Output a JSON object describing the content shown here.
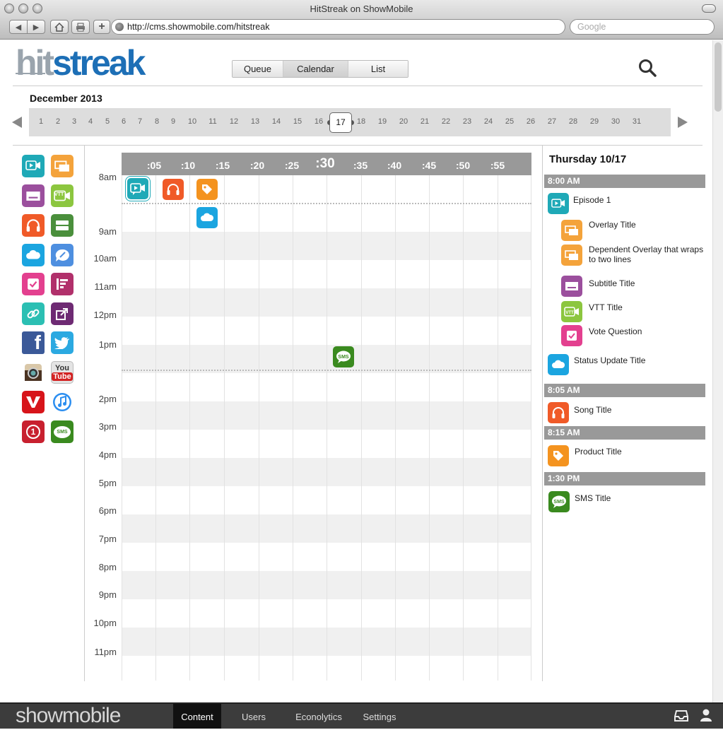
{
  "browser": {
    "window_title": "HitStreak on ShowMobile",
    "url": "http://cms.showmobile.com/hitstreak",
    "search_placeholder": "Google"
  },
  "header": {
    "logo_part1": "hit",
    "logo_part2": "streak",
    "view_tabs": [
      "Queue",
      "Calendar",
      "List"
    ],
    "active_view": "Calendar"
  },
  "calendar": {
    "month_label": "December 2013",
    "days": [
      "1",
      "2",
      "3",
      "4",
      "5",
      "6",
      "7",
      "8",
      "9",
      "10",
      "11",
      "12",
      "13",
      "14",
      "15",
      "16",
      "17",
      "18",
      "19",
      "20",
      "21",
      "22",
      "23",
      "24",
      "25",
      "26",
      "27",
      "28",
      "29",
      "30",
      "31"
    ],
    "selected_day": "17",
    "minute_labels": [
      ":05",
      ":10",
      ":15",
      ":20",
      ":25",
      ":30",
      ":35",
      ":40",
      ":45",
      ":50",
      ":55"
    ],
    "hour_labels": [
      "8am",
      "9am",
      "10am",
      "11am",
      "12pm",
      "1pm",
      "2pm",
      "3pm",
      "4pm",
      "5pm",
      "6pm",
      "7pm",
      "8pm",
      "9pm",
      "10pm",
      "11pm"
    ]
  },
  "palette": {
    "items": [
      {
        "name": "video",
        "color": "#1fa9b7"
      },
      {
        "name": "overlay",
        "color": "#f4a33b"
      },
      {
        "name": "subtitle",
        "color": "#9b4f9d"
      },
      {
        "name": "vtt",
        "color": "#8cc63f"
      },
      {
        "name": "song",
        "color": "#f05a28"
      },
      {
        "name": "layers",
        "color": "#4a8f3c"
      },
      {
        "name": "status-update",
        "color": "#1ba5e0"
      },
      {
        "name": "comment",
        "color": "#4e8fe0"
      },
      {
        "name": "vote",
        "color": "#e3408f"
      },
      {
        "name": "list",
        "color": "#b1306b"
      },
      {
        "name": "link",
        "color": "#2bbfb3"
      },
      {
        "name": "share",
        "color": "#6e2a73"
      },
      {
        "name": "facebook",
        "color": "#3b5998"
      },
      {
        "name": "twitter",
        "color": "#2ba9e1"
      },
      {
        "name": "instagram",
        "color": "#6b4a35"
      },
      {
        "name": "youtube",
        "color": "#e4e4e4"
      },
      {
        "name": "vevo",
        "color": "#d7141a"
      },
      {
        "name": "itunes",
        "color": "#1a6fd8"
      },
      {
        "name": "one",
        "color": "#c8202f"
      },
      {
        "name": "sms",
        "color": "#3a8a1f"
      }
    ],
    "youtube_text_1": "You",
    "youtube_text_2": "Tube",
    "sms_text": "SMS",
    "one_text": "1",
    "vtt_text": "VTT"
  },
  "events": {
    "sms_label": "SMS"
  },
  "agenda": {
    "title": "Thursday 10/17",
    "groups": [
      {
        "time": "8:00 AM",
        "items": [
          {
            "label": "Episode 1",
            "type": "video",
            "color": "#1fa9b7"
          },
          {
            "label": "Overlay Title",
            "type": "overlay",
            "color": "#f4a33b"
          },
          {
            "label": "Dependent Overlay that wraps to two lines",
            "type": "overlay",
            "color": "#f4a33b"
          },
          {
            "label": "Subtitle Title",
            "type": "subtitle",
            "color": "#9b4f9d"
          },
          {
            "label": "VTT Title",
            "type": "vtt",
            "color": "#8cc63f"
          },
          {
            "label": "Vote Question",
            "type": "vote",
            "color": "#e3408f"
          },
          {
            "label": "Status Update Title",
            "type": "status-update",
            "color": "#1ba5e0"
          }
        ]
      },
      {
        "time": "8:05 AM",
        "items": [
          {
            "label": "Song Title",
            "type": "song",
            "color": "#f05a28"
          }
        ]
      },
      {
        "time": "8:15 AM",
        "items": [
          {
            "label": "Product Title",
            "type": "product",
            "color": "#f4a33b"
          }
        ]
      },
      {
        "time": "1:30 PM",
        "items": [
          {
            "label": "SMS Title",
            "type": "sms",
            "color": "#3a8a1f"
          }
        ]
      }
    ]
  },
  "footer": {
    "logo": "showmobile",
    "tabs": [
      "Content",
      "Users",
      "Econolytics",
      "Settings"
    ],
    "active_tab": "Content"
  }
}
